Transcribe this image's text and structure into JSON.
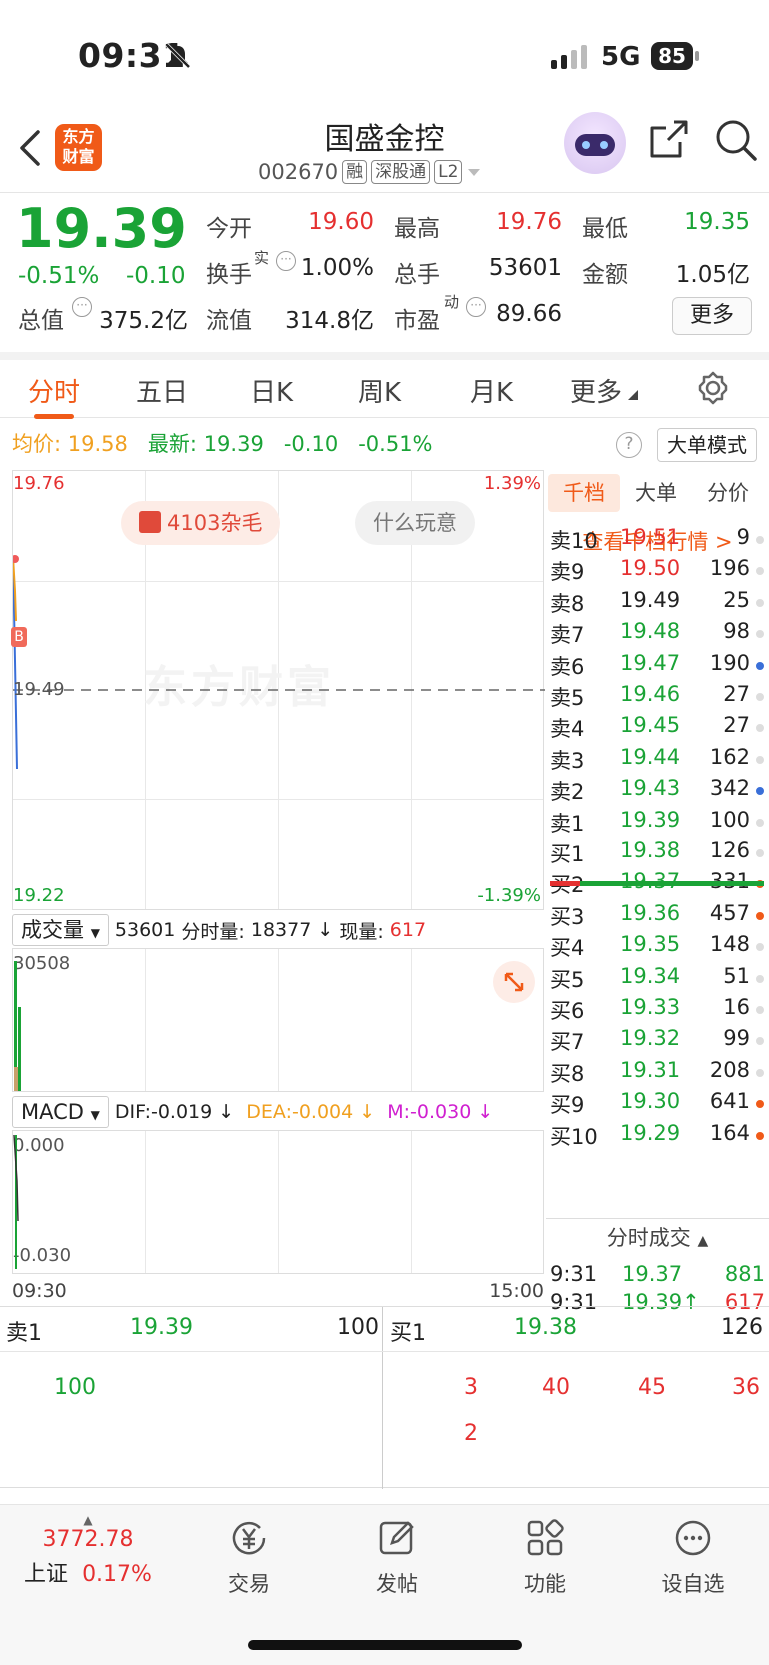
{
  "status": {
    "time": "09:31",
    "network": "5G",
    "battery": "85"
  },
  "header": {
    "logo_line1": "东方",
    "logo_line2": "财富",
    "stock_name": "国盛金控",
    "stock_code": "002670",
    "tags": [
      "融",
      "深股通",
      "L2"
    ]
  },
  "quote": {
    "price": "19.39",
    "change_pct": "-0.51%",
    "change": "-0.10",
    "open_label": "今开",
    "open": "19.60",
    "high_label": "最高",
    "high": "19.76",
    "low_label": "最低",
    "low": "19.35",
    "turnover_label": "换手",
    "turnover_sup": "实",
    "turnover": "1.00%",
    "volume_label": "总手",
    "volume": "53601",
    "amount_label": "金额",
    "amount": "1.05亿",
    "mktcap_label": "总值",
    "mktcap": "375.2亿",
    "float_label": "流值",
    "float": "314.8亿",
    "pe_label": "市盈",
    "pe_sup": "动",
    "pe": "89.66",
    "more_label": "更多"
  },
  "tabs": [
    "分时",
    "五日",
    "日K",
    "周K",
    "月K",
    "更多"
  ],
  "avg_row": {
    "avg_label": "均价:",
    "avg": "19.58",
    "latest_label": "最新:",
    "latest": "19.39",
    "chg": "-0.10",
    "pct": "-0.51%",
    "mode_label": "大单模式"
  },
  "chart": {
    "y_top": "19.76",
    "y_mid": "19.49",
    "y_bot": "19.22",
    "pct_top": "1.39%",
    "pct_bot": "-1.39%",
    "watermark": "东方财富",
    "pill_left": "4103杂毛",
    "pill_right": "什么玩意",
    "marker": "B"
  },
  "volume": {
    "selector": "成交量",
    "total": "53601",
    "fs_label": "分时量:",
    "fs_value": "18377",
    "now_label": "现量:",
    "now_value": "617",
    "max": "30508"
  },
  "macd": {
    "selector": "MACD",
    "dif": "DIF:-0.019",
    "dea": "DEA:-0.004",
    "m": "M:-0.030",
    "top": "0.000",
    "bot": "-0.030"
  },
  "time_axis": {
    "start": "09:30",
    "end": "15:00"
  },
  "book": {
    "tabs": [
      "千档",
      "大单",
      "分价"
    ],
    "link": "查看千档行情 >",
    "asks": [
      {
        "label": "卖10",
        "price": "19.51",
        "vol": "9",
        "pc": "red"
      },
      {
        "label": "卖9",
        "price": "19.50",
        "vol": "196",
        "pc": "red"
      },
      {
        "label": "卖8",
        "price": "19.49",
        "vol": "25",
        "pc": "gray"
      },
      {
        "label": "卖7",
        "price": "19.48",
        "vol": "98",
        "pc": "green"
      },
      {
        "label": "卖6",
        "price": "19.47",
        "vol": "190",
        "pc": "green",
        "dot": "#3a6fd8"
      },
      {
        "label": "卖5",
        "price": "19.46",
        "vol": "27",
        "pc": "green"
      },
      {
        "label": "卖4",
        "price": "19.45",
        "vol": "27",
        "pc": "green"
      },
      {
        "label": "卖3",
        "price": "19.44",
        "vol": "162",
        "pc": "green"
      },
      {
        "label": "卖2",
        "price": "19.43",
        "vol": "342",
        "pc": "green",
        "dot": "#3a6fd8"
      },
      {
        "label": "卖1",
        "price": "19.39",
        "vol": "100",
        "pc": "green"
      }
    ],
    "bids": [
      {
        "label": "买1",
        "price": "19.38",
        "vol": "126",
        "pc": "green"
      },
      {
        "label": "买2",
        "price": "19.37",
        "vol": "331",
        "pc": "green",
        "dot": "#f05a18"
      },
      {
        "label": "买3",
        "price": "19.36",
        "vol": "457",
        "pc": "green",
        "dot": "#f05a18"
      },
      {
        "label": "买4",
        "price": "19.35",
        "vol": "148",
        "pc": "green"
      },
      {
        "label": "买5",
        "price": "19.34",
        "vol": "51",
        "pc": "green"
      },
      {
        "label": "买6",
        "price": "19.33",
        "vol": "16",
        "pc": "green"
      },
      {
        "label": "买7",
        "price": "19.32",
        "vol": "99",
        "pc": "green"
      },
      {
        "label": "买8",
        "price": "19.31",
        "vol": "208",
        "pc": "green"
      },
      {
        "label": "买9",
        "price": "19.30",
        "vol": "641",
        "pc": "green",
        "dot": "#f05a18"
      },
      {
        "label": "买10",
        "price": "19.29",
        "vol": "164",
        "pc": "green",
        "dot": "#f05a18"
      }
    ]
  },
  "trades": {
    "title": "分时成交",
    "rows": [
      {
        "time": "9:31",
        "price": "19.37",
        "vol": "881"
      },
      {
        "time": "9:31",
        "price": "19.39↑",
        "vol": "617"
      }
    ]
  },
  "level1": {
    "ask_label": "卖1",
    "ask_price": "19.39",
    "ask_vol": "100",
    "bid_label": "买1",
    "bid_price": "19.38",
    "bid_vol": "126",
    "ask_queue": [
      "100"
    ],
    "bid_queue": [
      "3",
      "40",
      "45",
      "36",
      "2"
    ]
  },
  "nav": {
    "index_value": "3772.78",
    "index_name": "上证",
    "index_pct": "0.17%",
    "items": [
      "交易",
      "发帖",
      "功能",
      "设自选"
    ]
  }
}
